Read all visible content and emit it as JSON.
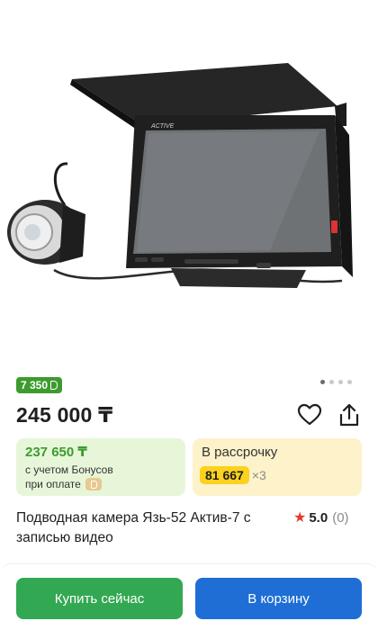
{
  "product": {
    "image_icon": "underwater-camera-photo",
    "screen_brand": "ACTIVE",
    "bonus_chip": "7 350",
    "bonus_chip_icon": "bonus-b-icon",
    "gallery_dots": 4,
    "gallery_active_index": 0,
    "price": "245 000 ₸",
    "bonus_card": {
      "amount": "237 650 ₸",
      "note_line1": "с учетом Бонусов",
      "note_line2": "при оплате",
      "color": "#3d9b2e"
    },
    "installment_card": {
      "label": "В рассрочку",
      "amount": "81 667",
      "multiplier": "×3",
      "highlight_color": "#fbd21e"
    },
    "title": "Подводная камера Язь-52 Актив-7 с записью видео",
    "rating": {
      "icon": "star-icon",
      "value": "5.0",
      "count": "(0)"
    }
  },
  "actions": {
    "buy_now_label": "Купить сейчас",
    "add_to_cart_label": "В корзину",
    "buy_color": "#33a852",
    "cart_color": "#1e6ed6"
  }
}
